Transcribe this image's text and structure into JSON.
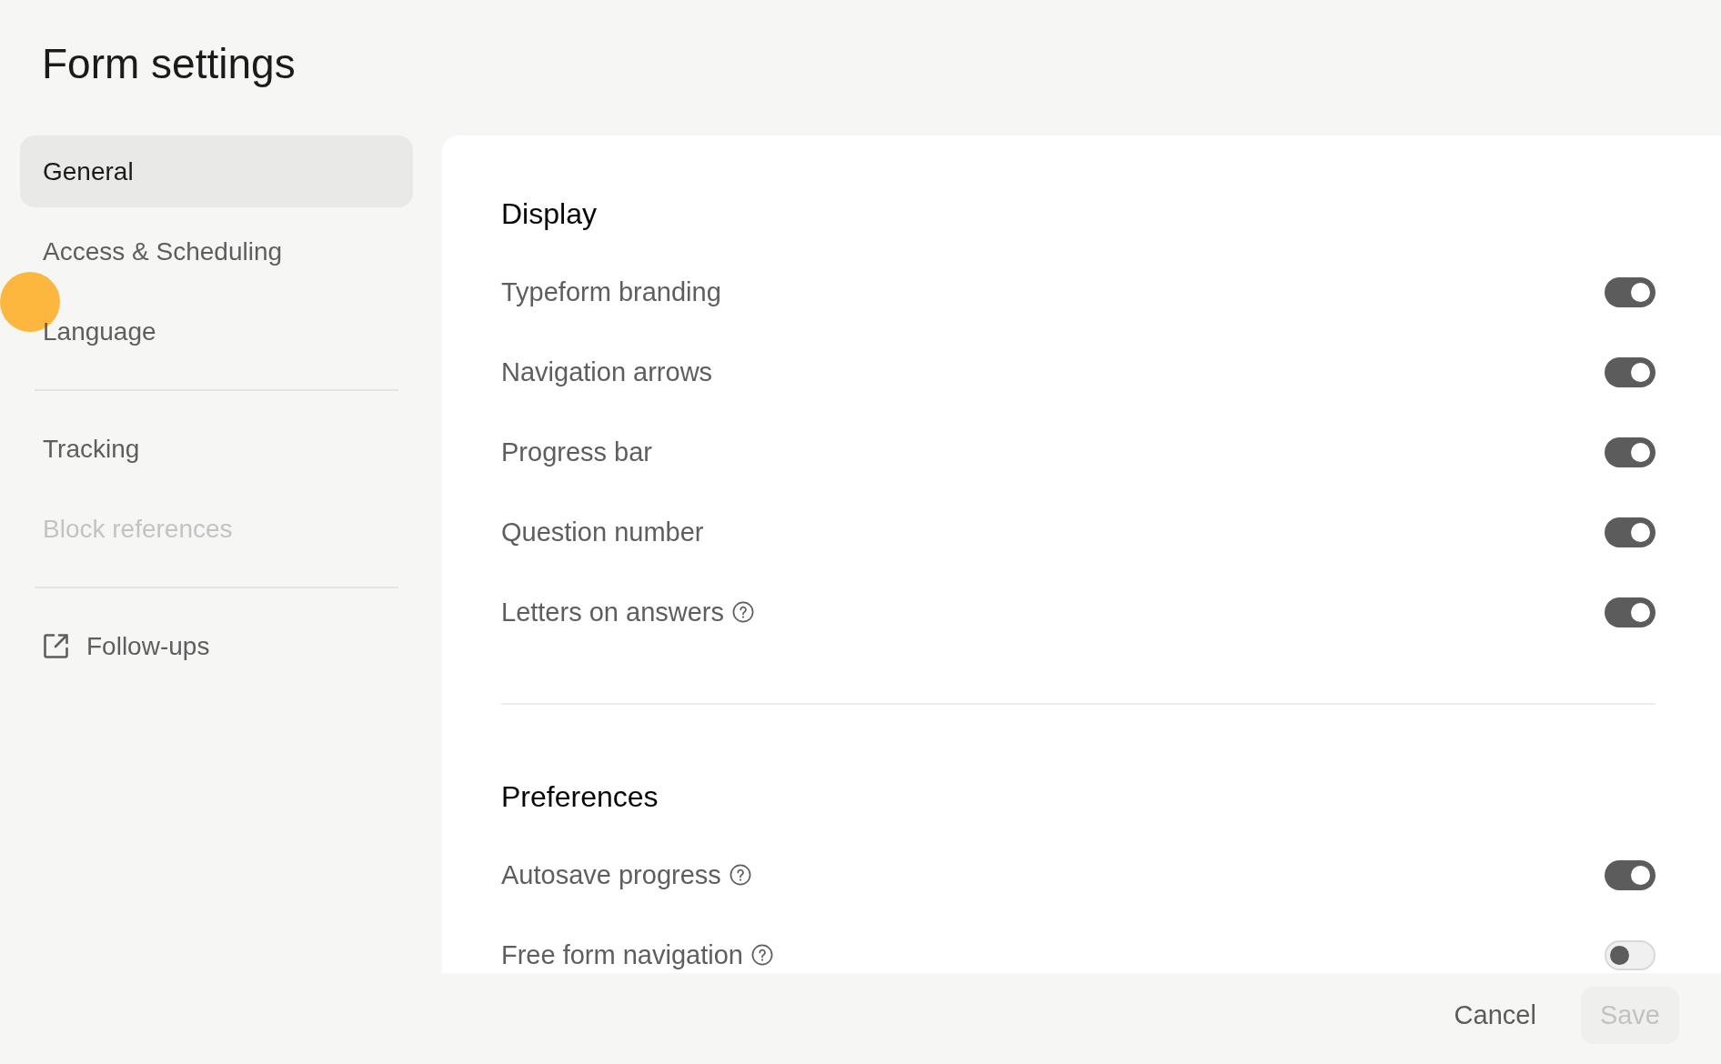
{
  "title": "Form settings",
  "sidebar": {
    "groups": [
      {
        "items": [
          {
            "label": "General",
            "kind": "page",
            "selected": true,
            "disabled": false
          },
          {
            "label": "Access & Scheduling",
            "kind": "page",
            "selected": false,
            "disabled": false
          },
          {
            "label": "Language",
            "kind": "page",
            "selected": false,
            "disabled": false
          }
        ]
      },
      {
        "items": [
          {
            "label": "Tracking",
            "kind": "page",
            "selected": false,
            "disabled": false
          },
          {
            "label": "Block references",
            "kind": "page",
            "selected": false,
            "disabled": true
          }
        ]
      },
      {
        "items": [
          {
            "label": "Follow-ups",
            "kind": "external",
            "selected": false,
            "disabled": false
          }
        ]
      }
    ]
  },
  "sections": [
    {
      "title": "Display",
      "settings": [
        {
          "label": "Typeform branding",
          "help": false,
          "on": true
        },
        {
          "label": "Navigation arrows",
          "help": false,
          "on": true
        },
        {
          "label": "Progress bar",
          "help": false,
          "on": true
        },
        {
          "label": "Question number",
          "help": false,
          "on": true
        },
        {
          "label": "Letters on answers",
          "help": true,
          "on": true
        }
      ]
    },
    {
      "title": "Preferences",
      "settings": [
        {
          "label": "Autosave progress",
          "help": true,
          "on": true
        },
        {
          "label": "Free form navigation",
          "help": true,
          "on": false
        }
      ]
    }
  ],
  "footer": {
    "buttons": [
      {
        "label": "Cancel",
        "kind": "text",
        "disabled": false
      },
      {
        "label": "Save",
        "kind": "filled",
        "disabled": true
      }
    ]
  }
}
